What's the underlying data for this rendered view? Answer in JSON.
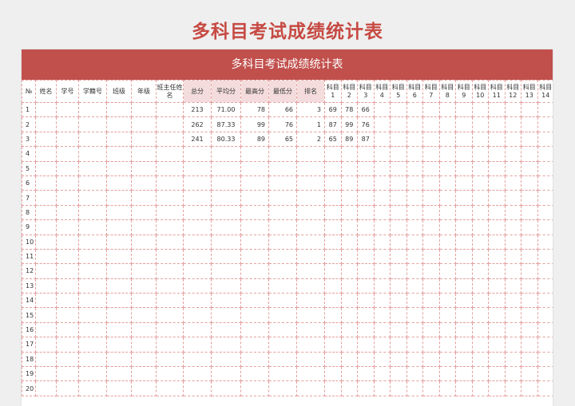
{
  "page_title": "多科目考试成绩统计表",
  "sheet_title": "多科目考试成绩统计表",
  "headers": {
    "no": "№",
    "name": "姓名",
    "student_id": "学号",
    "register_no": "学籍号",
    "class": "班级",
    "grade": "年级",
    "teacher": "班主任姓名",
    "total": "总分",
    "average": "平均分",
    "max": "最高分",
    "min": "最低分",
    "rank": "排名"
  },
  "subjects": [
    {
      "top": "科目",
      "num": "1"
    },
    {
      "top": "科目",
      "num": "2"
    },
    {
      "top": "科目",
      "num": "3"
    },
    {
      "top": "科目",
      "num": "4"
    },
    {
      "top": "科目",
      "num": "5"
    },
    {
      "top": "科目",
      "num": "6"
    },
    {
      "top": "科目",
      "num": "7"
    },
    {
      "top": "科目",
      "num": "8"
    },
    {
      "top": "科目",
      "num": "9"
    },
    {
      "top": "科目",
      "num": "10"
    },
    {
      "top": "科目",
      "num": "11"
    },
    {
      "top": "科目",
      "num": "12"
    },
    {
      "top": "科目",
      "num": "13"
    },
    {
      "top": "科目",
      "num": "14"
    }
  ],
  "rows": [
    {
      "no": "1",
      "total": "213",
      "average": "71.00",
      "max": "78",
      "min": "66",
      "rank": "3",
      "scores": [
        "69",
        "78",
        "66"
      ]
    },
    {
      "no": "2",
      "total": "262",
      "average": "87.33",
      "max": "99",
      "min": "76",
      "rank": "1",
      "scores": [
        "87",
        "99",
        "76"
      ]
    },
    {
      "no": "3",
      "total": "241",
      "average": "80.33",
      "max": "89",
      "min": "65",
      "rank": "2",
      "scores": [
        "65",
        "89",
        "87"
      ]
    },
    {
      "no": "4"
    },
    {
      "no": "5"
    },
    {
      "no": "6"
    },
    {
      "no": "7"
    },
    {
      "no": "8"
    },
    {
      "no": "9"
    },
    {
      "no": "10"
    },
    {
      "no": "11"
    },
    {
      "no": "12"
    },
    {
      "no": "13"
    },
    {
      "no": "14"
    },
    {
      "no": "15"
    },
    {
      "no": "16"
    },
    {
      "no": "17"
    },
    {
      "no": "18"
    },
    {
      "no": "19"
    },
    {
      "no": "20"
    }
  ]
}
